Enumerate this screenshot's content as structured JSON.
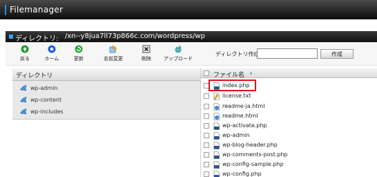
{
  "app": {
    "title": "Filemanager",
    "accent_color": "#1e90ff"
  },
  "directory": {
    "label": "ディレクトリ:",
    "path": "/xn--y8jua7ll73p866c.com/wordpress/wp"
  },
  "toolbar": {
    "items": [
      {
        "label": "戻る",
        "icon": "back-icon"
      },
      {
        "label": "ホーム",
        "icon": "home-icon"
      },
      {
        "label": "更新",
        "icon": "refresh-icon"
      },
      {
        "label": "名前変更",
        "icon": "rename-icon"
      },
      {
        "label": "削除",
        "icon": "delete-icon"
      },
      {
        "label": "アップロード",
        "icon": "upload-icon"
      }
    ],
    "mkdir_label": "ディレクトリ作成 :",
    "mkdir_value": "",
    "mkdir_button": "作成"
  },
  "tree": {
    "header": "ディレクトリ",
    "items": [
      {
        "label": "wp-admin",
        "icon": "wordpress-folder-icon"
      },
      {
        "label": "wp-content",
        "icon": "wordpress-folder-icon"
      },
      {
        "label": "wp-includes",
        "icon": "wordpress-folder-icon"
      }
    ]
  },
  "files": {
    "header": "ファイル名",
    "sort_indicator": "∧",
    "items": [
      {
        "name": "index.php",
        "type": "php",
        "highlighted": true
      },
      {
        "name": "license.txt",
        "type": "txt"
      },
      {
        "name": "readme-ja.html",
        "type": "html"
      },
      {
        "name": "readme.html",
        "type": "html"
      },
      {
        "name": "wp-activate.php",
        "type": "php"
      },
      {
        "name": "wp-admin",
        "type": "php"
      },
      {
        "name": "wp-blog-header.php",
        "type": "php"
      },
      {
        "name": "wp-comments-post.php",
        "type": "php"
      },
      {
        "name": "wp-config-sample.php",
        "type": "php"
      },
      {
        "name": "wp-config.php",
        "type": "php"
      }
    ]
  }
}
